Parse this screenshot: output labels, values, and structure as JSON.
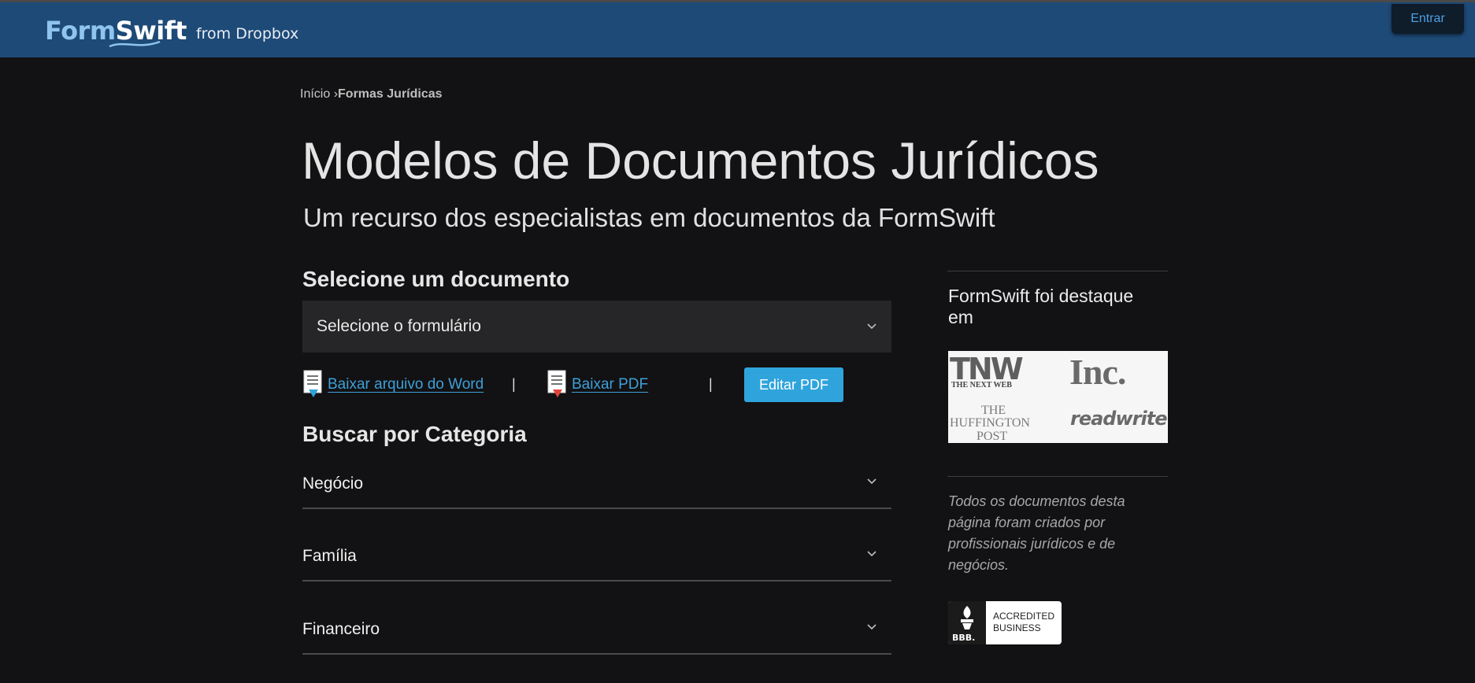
{
  "header": {
    "logo_part1": "Form",
    "logo_part2": "Swift",
    "logo_tagline": "from Dropbox",
    "login_label": "Entrar"
  },
  "breadcrumb": {
    "home": "Início",
    "separator": "›",
    "current": "Formas Jurídicas"
  },
  "main": {
    "title": "Modelos de Documentos Jurídicos",
    "subtitle": "Um recurso dos especialistas em documentos da FormSwift",
    "select_heading": "Selecione um documento",
    "select_value": "Selecione o formulário",
    "word_link": "Baixar arquivo do Word",
    "pdf_link": "Baixar PDF",
    "separator": "|",
    "edit_pdf_label": "Editar PDF",
    "category_heading": "Buscar por Categoria",
    "categories": [
      {
        "label": "Negócio"
      },
      {
        "label": "Família"
      },
      {
        "label": "Financeiro"
      }
    ]
  },
  "sidebar": {
    "featured_heading": "FormSwift foi destaque em",
    "press": {
      "tnw": "TNW",
      "tnw_sub": "THE NEXT WEB",
      "inc": "Inc.",
      "huffington_1": "THE",
      "huffington_2": "HUFFINGTON",
      "huffington_3": "POST",
      "readwrite": "readwrite"
    },
    "disclaimer": "Todos os documentos desta página foram criados por profissionais jurídicos e de negócios.",
    "bbb": {
      "logo_text": "BBB.",
      "line1": "ACCREDITED",
      "line2": "BUSINESS"
    }
  },
  "colors": {
    "header_bg": "#1e4a78",
    "page_bg": "#121113",
    "link": "#3ea0d8",
    "button": "#2fa4dc"
  },
  "icons": [
    "chevron-down-icon",
    "word-document-icon",
    "pdf-document-icon",
    "bbb-torch-icon"
  ]
}
